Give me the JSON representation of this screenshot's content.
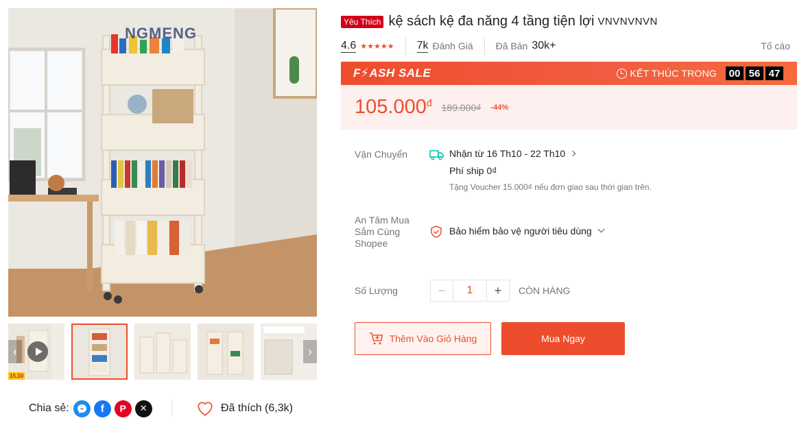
{
  "gallery": {
    "brand_watermark": "NGMENG",
    "video_promo_tag": "15.10",
    "prev_arrow": "‹",
    "next_arrow": "›"
  },
  "share": {
    "label": "Chia sẻ:",
    "networks": [
      "messenger-icon",
      "facebook-icon",
      "pinterest-icon",
      "x-twitter-icon"
    ]
  },
  "like": {
    "label": "Đã thích (6,3k)"
  },
  "product": {
    "badge": "Yêu Thích",
    "title": "kệ sách kệ đa năng 4 tầng tiện lợi",
    "title_suffix": "VNVNVNVN"
  },
  "rating": {
    "score": "4.6",
    "stars": 4.6,
    "review_count": "7k",
    "review_label": "Đánh Giá",
    "sold_label": "Đã Bán",
    "sold_count": "30k+",
    "report_label": "Tố cáo"
  },
  "flash_sale": {
    "logo_prefix": "F",
    "logo_suffix": "ASH SALE",
    "ends_label": "KẾT THÚC TRONG",
    "hours": "00",
    "minutes": "56",
    "seconds": "47"
  },
  "price": {
    "current": "105.000",
    "currency": "đ",
    "original": "189.000₫",
    "discount": "-44%"
  },
  "shipping": {
    "label": "Vận Chuyển",
    "delivery": "Nhận từ 16 Th10 - 22 Th10",
    "fee": "Phí ship 0₫",
    "voucher_note": "Tặng Voucher 15.000₫ nếu đơn giao sau thời gian trên."
  },
  "guarantee": {
    "label": "An Tâm Mua Sắm Cùng Shopee",
    "text": "Bảo hiểm bảo vệ người tiêu dùng"
  },
  "quantity": {
    "label": "Số Lượng",
    "minus": "−",
    "value": "1",
    "plus": "+",
    "stock": "CÒN HÀNG"
  },
  "actions": {
    "add_to_cart": "Thêm Vào Giỏ Hàng",
    "buy_now": "Mua Ngay"
  },
  "colors": {
    "brand": "#ee4d2d",
    "badge": "#d0011b",
    "price_bg": "#fdf0ee"
  }
}
